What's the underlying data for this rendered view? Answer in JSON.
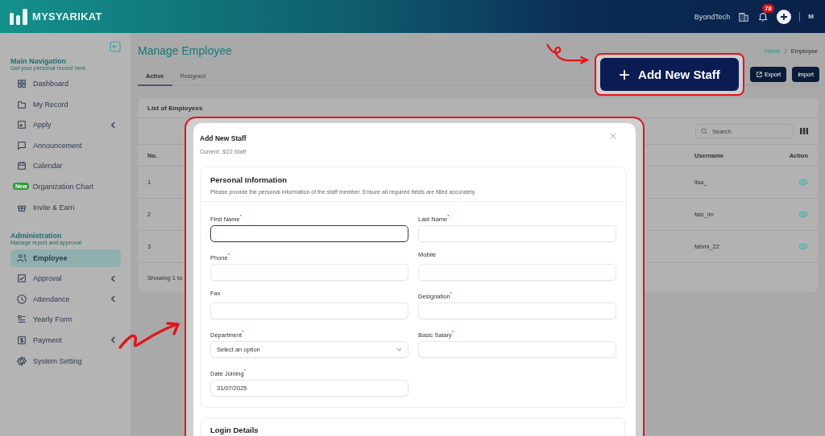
{
  "header": {
    "logo": "MYSYARIKAT",
    "company": "ByondTech",
    "notification_count": "78",
    "user_initial": "M"
  },
  "sidebar": {
    "sections": [
      {
        "title": "Main Navigation",
        "subtitle": "Get your personal record here",
        "items": [
          {
            "label": "Dashboard",
            "selected": false,
            "expandable": false
          },
          {
            "label": "My Record",
            "selected": false,
            "expandable": false
          },
          {
            "label": "Apply",
            "selected": false,
            "expandable": true
          },
          {
            "label": "Announcement",
            "selected": false,
            "expandable": false
          },
          {
            "label": "Calendar",
            "selected": false,
            "expandable": false
          },
          {
            "label": "Organization Chart",
            "selected": false,
            "expandable": false,
            "badge": "New"
          },
          {
            "label": "Invite & Earn",
            "selected": false,
            "expandable": false
          }
        ]
      },
      {
        "title": "Administration",
        "subtitle": "Manage report and approval",
        "items": [
          {
            "label": "Employee",
            "selected": true,
            "expandable": false
          },
          {
            "label": "Approval",
            "selected": false,
            "expandable": true
          },
          {
            "label": "Attendance",
            "selected": false,
            "expandable": true
          },
          {
            "label": "Yearly Form",
            "selected": false,
            "expandable": false
          },
          {
            "label": "Payment",
            "selected": false,
            "expandable": true
          },
          {
            "label": "System Setting",
            "selected": false,
            "expandable": false
          }
        ]
      }
    ]
  },
  "page": {
    "title": "Manage Employee",
    "breadcrumb": [
      "Home",
      "Employee"
    ],
    "tabs": [
      {
        "label": "Active",
        "selected": true
      },
      {
        "label": "Resigned",
        "selected": false
      }
    ],
    "buttons": {
      "add": {
        "icon": "+",
        "label": "Add New Staff"
      },
      "export": "Export",
      "import": "Import"
    }
  },
  "table": {
    "title": "List of Employees",
    "search": {
      "placeholder": "Search"
    },
    "columns": [
      "No.",
      "Username",
      "Action"
    ],
    "rows": [
      {
        "no": "1",
        "username": "lisa_"
      },
      {
        "no": "2",
        "username": "faiz_im"
      },
      {
        "no": "3",
        "username": "fahmi_22"
      }
    ],
    "footer": "Showing 1 to"
  },
  "modal": {
    "title": "Add New Staff",
    "subtitle": "Current: 3/22 Staff",
    "section": {
      "title": "Personal Information",
      "description": "Please provide the personal information of the staff member. Ensure all required fields are filled accurately.",
      "fields": [
        {
          "label": "First Name$^{*}$",
          "kind": "text",
          "focused": true
        },
        {
          "label": "Last Name$^{*}$",
          "kind": "text",
          "focused": false
        },
        {
          "label": "Phone$^{*}$",
          "kind": "text",
          "focused": false
        },
        {
          "label": "Mobile",
          "kind": "text",
          "focused": false
        },
        {
          "label": "Fax",
          "kind": "text",
          "focused": false
        },
        {
          "label": "Designation$^{*}$",
          "kind": "text",
          "focused": false
        },
        {
          "label": "Department$^{*}$",
          "kind": "select",
          "focused": false,
          "placeholder": "Select an option"
        },
        {
          "label": "Basic Salary$^{*}$",
          "kind": "text",
          "focused": false
        },
        {
          "label": "Date Joining$^{*}$",
          "kind": "text",
          "focused": false,
          "value": "31/07/2025"
        }
      ]
    },
    "next_section": "Login Details"
  }
}
